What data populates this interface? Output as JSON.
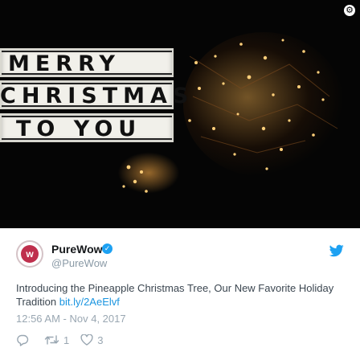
{
  "media": {
    "lightbox_lines": [
      "MERRY",
      "CHRISTMAS",
      "TO YOU"
    ],
    "settings_icon": "settings-badge-icon",
    "colors": {
      "background": "#050505",
      "light": "#f4b24a",
      "lightbox": "#f1f0ea"
    }
  },
  "tweet": {
    "author": {
      "name": "PureWow",
      "handle": "@PureWow",
      "avatar_letter": "w",
      "avatar_color": "#bf2f4d",
      "verified": true
    },
    "text": "Introducing the Pineapple Christmas Tree, Our New Favorite Holiday Tradition",
    "link": "bit.ly/2AeElvf",
    "timestamp": "12:56 AM - Nov 4, 2017",
    "actions": {
      "reply_count": "",
      "retweet_count": "1",
      "like_count": "3"
    },
    "colors": {
      "link": "#1b95e0",
      "meta": "#9aa7b2",
      "verified": "#1da1f2",
      "brand": "#1da1f2"
    }
  }
}
